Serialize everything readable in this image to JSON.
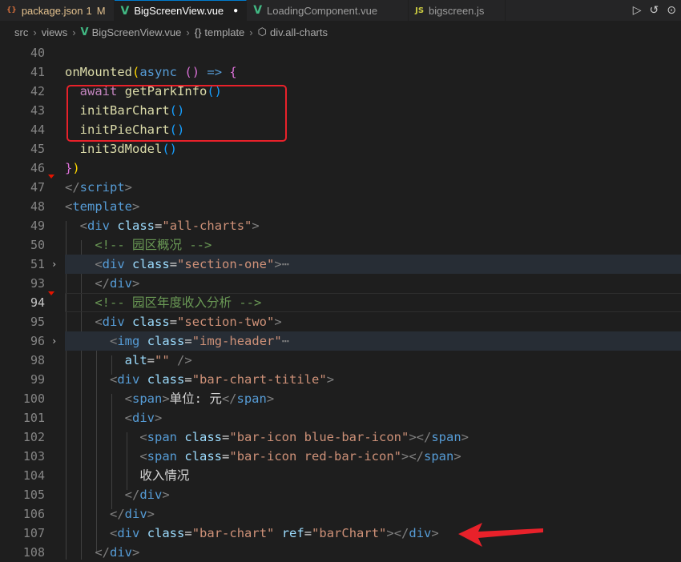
{
  "tabs": [
    {
      "icon_text": "{}",
      "icon": "json-icon",
      "label": "package.json",
      "badge": "1",
      "modified": "M"
    },
    {
      "icon_text": "V",
      "icon": "vue-icon",
      "label": "BigScreenView.vue",
      "dirty": "●",
      "active": true
    },
    {
      "icon_text": "V",
      "icon": "vue-icon",
      "label": "LoadingComponent.vue"
    },
    {
      "icon_text": "JS",
      "icon": "js-icon",
      "label": "bigscreen.js"
    }
  ],
  "toolbar": {
    "run": "▷",
    "history": "↺",
    "back": "⊙"
  },
  "breadcrumb": [
    "src",
    "views",
    "BigScreenView.vue",
    "template",
    "div.all-charts"
  ],
  "lines": [
    {
      "n": "40"
    },
    {
      "n": "41"
    },
    {
      "n": "42"
    },
    {
      "n": "43"
    },
    {
      "n": "44"
    },
    {
      "n": "45"
    },
    {
      "n": "46"
    },
    {
      "n": "47"
    },
    {
      "n": "48"
    },
    {
      "n": "49"
    },
    {
      "n": "50"
    },
    {
      "n": "51"
    },
    {
      "n": "93"
    },
    {
      "n": "94"
    },
    {
      "n": "95"
    },
    {
      "n": "96"
    },
    {
      "n": "98"
    },
    {
      "n": "99"
    },
    {
      "n": "100"
    },
    {
      "n": "101"
    },
    {
      "n": "102"
    },
    {
      "n": "103"
    },
    {
      "n": "104"
    },
    {
      "n": "105"
    },
    {
      "n": "106"
    },
    {
      "n": "107"
    },
    {
      "n": "108"
    }
  ],
  "code": {
    "onMounted": "onMounted",
    "async": "async",
    "arrow": "=>",
    "await": "await",
    "getParkInfo": "getParkInfo",
    "initBarChart": "initBarChart",
    "initPieChart": "initPieChart",
    "init3dModel": "init3dModel",
    "script": "script",
    "template": "template",
    "div": "div",
    "class": "class",
    "all_charts": "\"all-charts\"",
    "comment1": "<!-- 园区概况 -->",
    "section_one": "\"section-one\"",
    "comment2": "<!-- 园区年度收入分析 -->",
    "section_two": "\"section-two\"",
    "img": "img",
    "img_header": "\"img-header\"",
    "alt": "alt",
    "empty_str": "\"\"",
    "bar_chart_titile": "\"bar-chart-titile\"",
    "span": "span",
    "unit_text": "单位: 元",
    "blue_bar": "\"bar-icon blue-bar-icon\"",
    "red_bar": "\"bar-icon red-bar-icon\"",
    "income_text": "收入情况",
    "bar_chart": "\"bar-chart\"",
    "ref": "ref",
    "bar_chart_ref": "\"barChart\"",
    "ellipsis": "⋯"
  },
  "colors": {
    "annotation": "#e8212a",
    "accent": "#007acc"
  }
}
